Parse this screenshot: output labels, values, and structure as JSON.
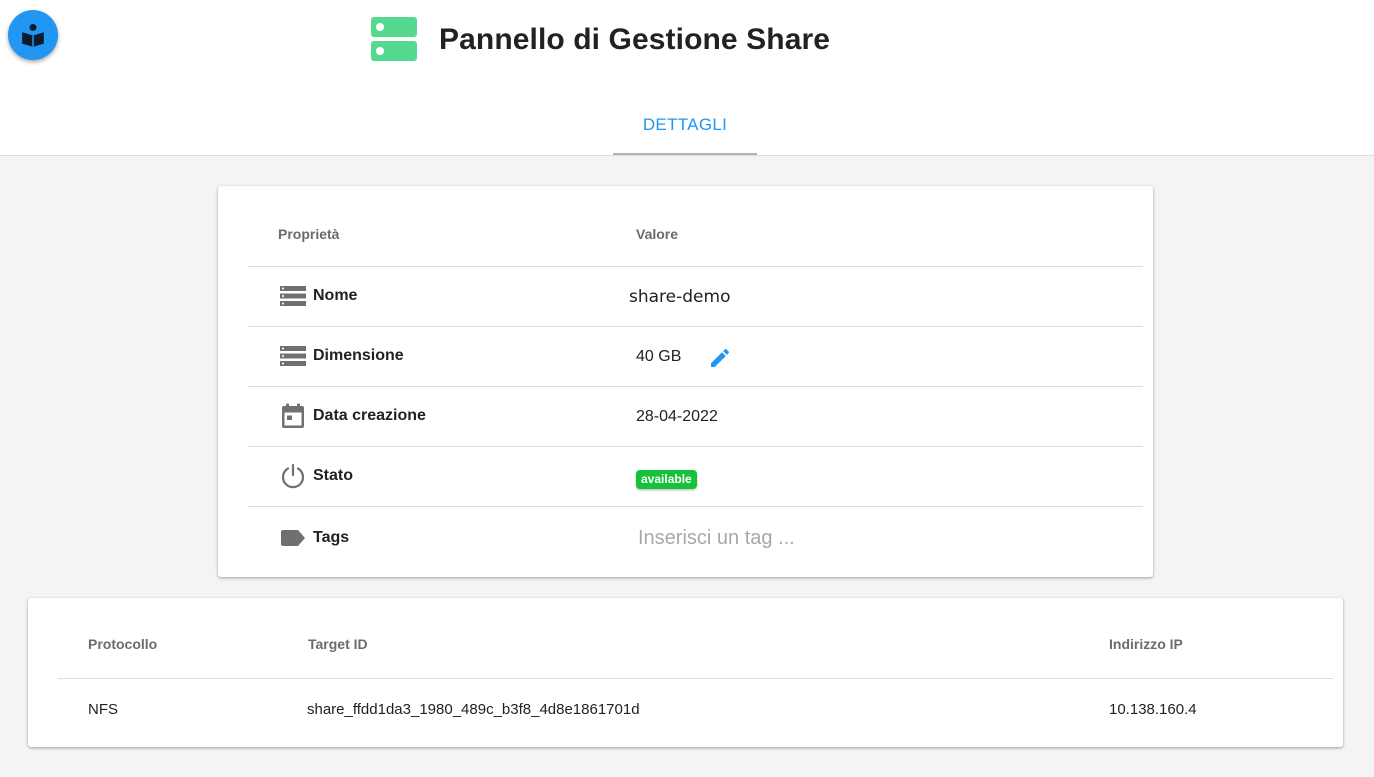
{
  "header": {
    "title": "Pannello di Gestione Share",
    "help_icon": "book-reader-icon",
    "title_icon": "server-icon",
    "accent_color": "#2196f3",
    "title_icon_color": "#55d98f"
  },
  "tabs": [
    {
      "label": "DETTAGLI",
      "active": true
    }
  ],
  "details": {
    "columns": {
      "property": "Proprietà",
      "value": "Valore"
    },
    "rows": {
      "name": {
        "label": "Nome",
        "value": "share-demo",
        "icon": "storage-icon"
      },
      "size": {
        "label": "Dimensione",
        "value": "40 GB",
        "icon": "storage-icon",
        "edit_icon": "pencil-icon"
      },
      "created": {
        "label": "Data creazione",
        "value": "28-04-2022",
        "icon": "calendar-icon"
      },
      "status": {
        "label": "Stato",
        "value": "available",
        "icon": "power-icon",
        "badge_color": "#16c23a"
      },
      "tags": {
        "label": "Tags",
        "placeholder": "Inserisci un tag ...",
        "icon": "label-icon"
      }
    }
  },
  "targets": {
    "columns": {
      "protocol": "Protocollo",
      "target_id": "Target ID",
      "ip": "Indirizzo IP"
    },
    "rows": [
      {
        "protocol": "NFS",
        "target_id": "share_ffdd1da3_1980_489c_b3f8_4d8e1861701d",
        "ip": "10.138.160.4"
      }
    ]
  }
}
